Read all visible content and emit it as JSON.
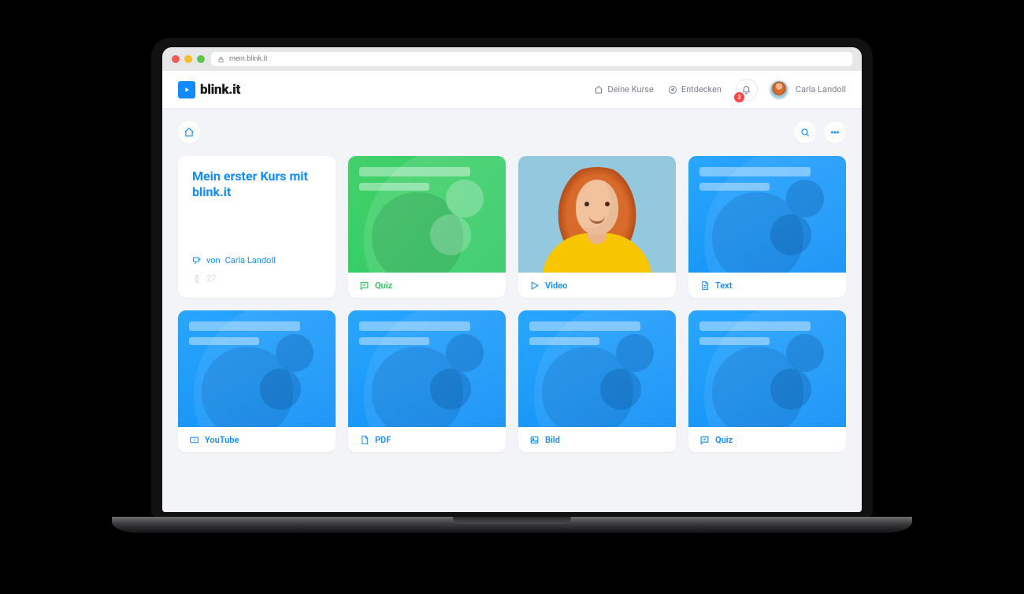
{
  "browser": {
    "url": "mein.blink.it"
  },
  "brand": "blink.it",
  "nav": {
    "courses": "Deine Kurse",
    "discover": "Entdecken"
  },
  "notifications": {
    "count": "3"
  },
  "user": {
    "name": "Carla Landoll"
  },
  "hero": {
    "title": "Mein erster Kurs mit blink.it",
    "author_prefix": "von",
    "author": "Carla Landoll",
    "count": "27"
  },
  "cards": {
    "quiz": {
      "label": "Quiz"
    },
    "video": {
      "label": "Video"
    },
    "text": {
      "label": "Text"
    },
    "youtube": {
      "label": "YouTube"
    },
    "pdf": {
      "label": "PDF"
    },
    "image": {
      "label": "Bild"
    },
    "quiz2": {
      "label": "Quiz"
    }
  }
}
